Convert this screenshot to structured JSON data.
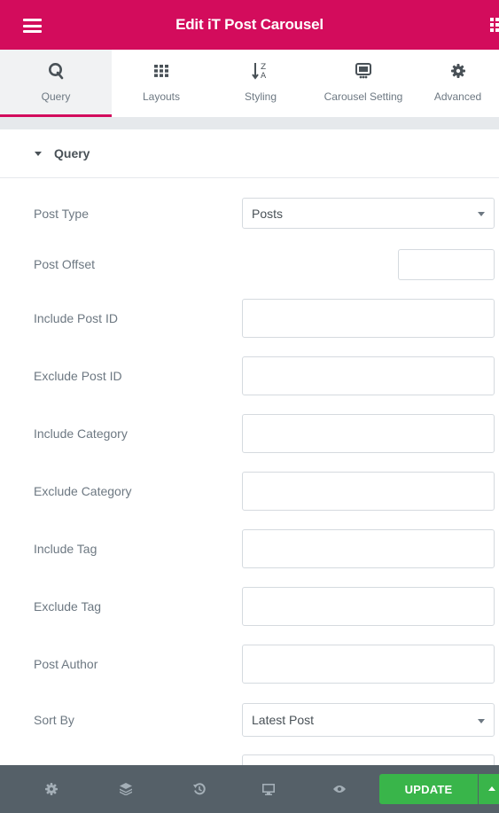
{
  "header": {
    "title": "Edit iT Post Carousel",
    "menu_icon": "hamburger-icon",
    "grid_icon": "grid-icon",
    "accent": "#d30c5c"
  },
  "tabs": [
    {
      "label": "Query",
      "icon": "query-icon",
      "active": true
    },
    {
      "label": "Layouts",
      "icon": "layouts-grid-icon",
      "active": false
    },
    {
      "label": "Styling",
      "icon": "sort-az-icon",
      "active": false
    },
    {
      "label": "Carousel Setting",
      "icon": "carousel-icon",
      "active": false
    },
    {
      "label": "Advanced",
      "icon": "gear-icon",
      "active": false
    }
  ],
  "section": {
    "title": "Query",
    "expanded": true
  },
  "fields": {
    "post_type": {
      "label": "Post Type",
      "value": "Posts"
    },
    "post_offset": {
      "label": "Post Offset",
      "value": ""
    },
    "include_post_id": {
      "label": "Include Post ID",
      "value": ""
    },
    "exclude_post_id": {
      "label": "Exclude Post ID",
      "value": ""
    },
    "include_category": {
      "label": "Include Category",
      "value": ""
    },
    "exclude_category": {
      "label": "Exclude Category",
      "value": ""
    },
    "include_tag": {
      "label": "Include Tag",
      "value": ""
    },
    "exclude_tag": {
      "label": "Exclude Tag",
      "value": ""
    },
    "post_author": {
      "label": "Post Author",
      "value": ""
    },
    "sort_by": {
      "label": "Sort By",
      "value": "Latest Post"
    }
  },
  "footer": {
    "icons": [
      "settings-icon",
      "layers-icon",
      "history-icon",
      "responsive-desktop-icon",
      "preview-eye-icon"
    ],
    "update_label": "UPDATE",
    "update_color": "#39b54a"
  }
}
